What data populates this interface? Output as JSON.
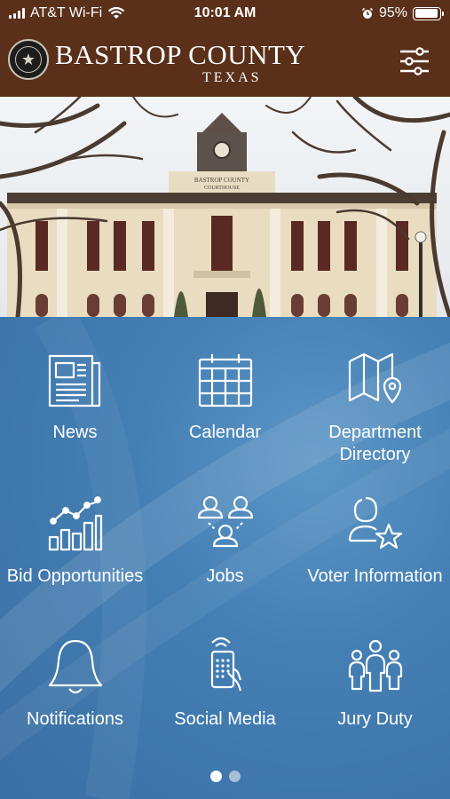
{
  "status_bar": {
    "carrier": "AT&T Wi-Fi",
    "time": "10:01 AM",
    "battery": "95%",
    "battery_level": 0.95
  },
  "header": {
    "brand_name": "BASTROP COUNTY",
    "brand_sub": "TEXAS",
    "seal_icon": "county-seal-icon",
    "menu_icon": "sliders-menu-icon"
  },
  "hero": {
    "sign_line1": "BASTROP COUNTY",
    "sign_line2": "COURTHOUSE"
  },
  "tiles": [
    {
      "label": "News",
      "icon": "newspaper-icon"
    },
    {
      "label": "Calendar",
      "icon": "calendar-icon"
    },
    {
      "label": "Department Directory",
      "icon": "map-pin-icon"
    },
    {
      "label": "Bid Opportunities",
      "icon": "bar-chart-icon"
    },
    {
      "label": "Jobs",
      "icon": "people-network-icon"
    },
    {
      "label": "Voter Information",
      "icon": "person-star-icon"
    },
    {
      "label": "Notifications",
      "icon": "bell-icon"
    },
    {
      "label": "Social Media",
      "icon": "phone-hand-icon"
    },
    {
      "label": "Jury Duty",
      "icon": "jury-people-icon"
    }
  ],
  "pager": {
    "pages": 2,
    "current": 1,
    "active_color": "#ffffff",
    "inactive_color": "#a9bfd6"
  },
  "colors": {
    "header_bg": "#5a301a",
    "grid_bg": "#3f79ad"
  }
}
